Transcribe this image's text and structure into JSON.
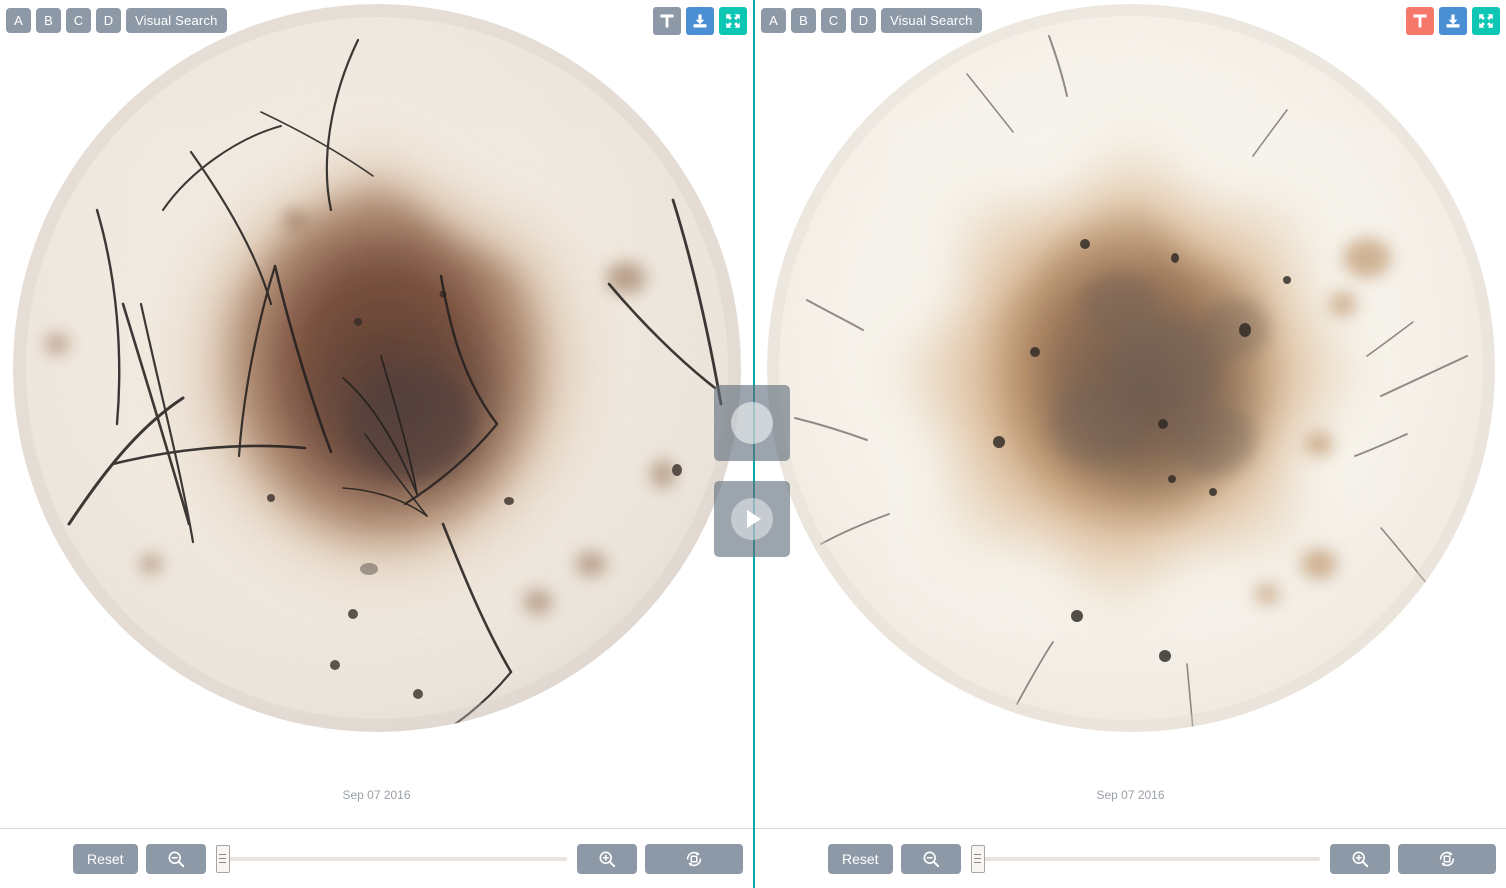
{
  "app": {
    "title": "Dermoscopy Image Comparison Viewer",
    "accent_teal": "#0ec6b4",
    "divider_color": "#0aa8a0",
    "button_gray": "#8d99a6",
    "button_blue": "#4a8fd4",
    "button_red": "#f4796b"
  },
  "panels": [
    {
      "id": "left",
      "toolbar": {
        "mode_buttons": [
          {
            "label": "A",
            "name": "mode-a",
            "active": false
          },
          {
            "label": "B",
            "name": "mode-b",
            "active": false
          },
          {
            "label": "C",
            "name": "mode-c",
            "active": false
          },
          {
            "label": "D",
            "name": "mode-d",
            "active": false
          }
        ],
        "visual_search_label": "Visual Search",
        "icons": [
          {
            "name": "text-annotation-icon",
            "label": "T",
            "state": "inactive",
            "color": "#8d99a6"
          },
          {
            "name": "download-icon",
            "label": "Download",
            "state": "normal",
            "color": "#4a8fd4"
          },
          {
            "name": "fullscreen-icon",
            "label": "Fullscreen",
            "state": "normal",
            "color": "#0ec6b4"
          }
        ]
      },
      "image": {
        "caption_date": "Sep 07 2016",
        "modality": "dermoscopy-polarized",
        "alt": "Circular dermoscopic view of a pigmented skin lesion with dark brown irregular center and terminal hairs"
      },
      "bottom": {
        "reset_label": "Reset",
        "zoom_out_name": "zoom-out-icon",
        "zoom_in_name": "zoom-in-icon",
        "rotate_name": "rotate-icon",
        "slider_value": 0,
        "slider_min": 0,
        "slider_max": 100
      }
    },
    {
      "id": "right",
      "toolbar": {
        "mode_buttons": [
          {
            "label": "A",
            "name": "mode-a",
            "active": false
          },
          {
            "label": "B",
            "name": "mode-b",
            "active": false
          },
          {
            "label": "C",
            "name": "mode-c",
            "active": false
          },
          {
            "label": "D",
            "name": "mode-d",
            "active": false
          }
        ],
        "visual_search_label": "Visual Search",
        "icons": [
          {
            "name": "text-annotation-icon",
            "label": "T",
            "state": "active",
            "color": "#f4796b"
          },
          {
            "name": "download-icon",
            "label": "Download",
            "state": "normal",
            "color": "#4a8fd4"
          },
          {
            "name": "fullscreen-icon",
            "label": "Fullscreen",
            "state": "normal",
            "color": "#0ec6b4"
          }
        ]
      },
      "image": {
        "caption_date": "Sep 07 2016",
        "modality": "dermoscopy-contact-immersion",
        "alt": "Circular dermoscopic view of the same lesion showing star-shaped orange-brown pigment network"
      },
      "bottom": {
        "reset_label": "Reset",
        "zoom_out_name": "zoom-out-icon",
        "zoom_in_name": "zoom-in-icon",
        "rotate_name": "rotate-icon",
        "slider_value": 0,
        "slider_min": 0,
        "slider_max": 100
      }
    }
  ],
  "center_controls": {
    "drag_handle_name": "sync-drag-handle",
    "play_button_name": "play-button"
  }
}
